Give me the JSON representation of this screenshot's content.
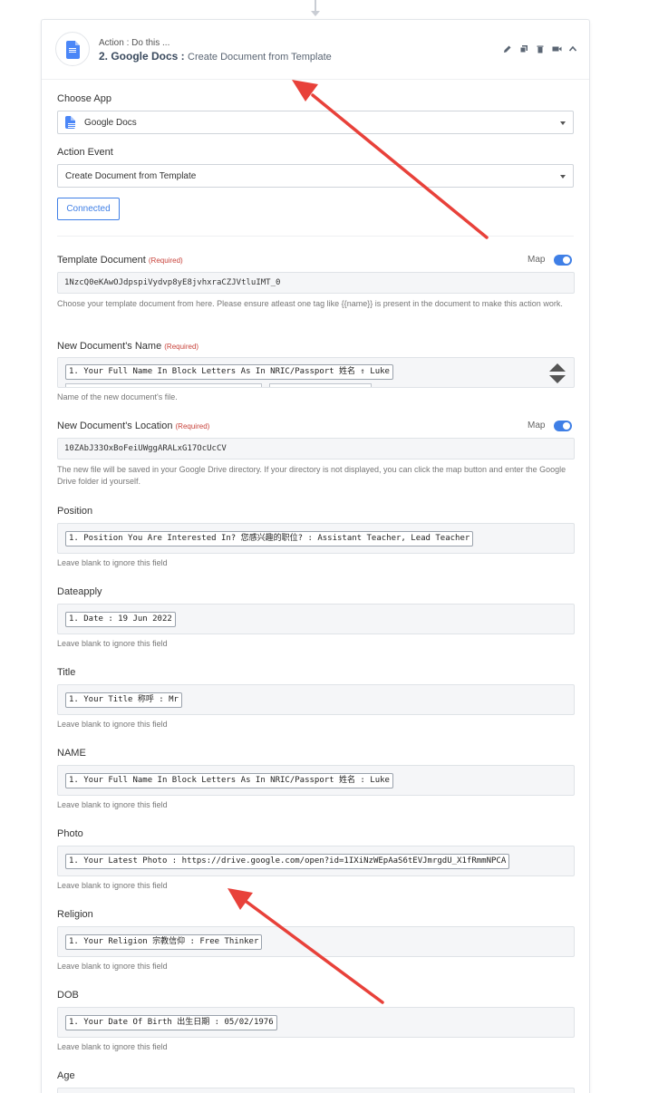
{
  "header": {
    "subtitle": "Action : Do this ...",
    "step": "2. Google Docs :",
    "action": "Create Document from Template",
    "tools": [
      "pencil-icon",
      "copy-icon",
      "trash-icon",
      "video-icon",
      "chevron-up-icon"
    ]
  },
  "choose_app": {
    "label": "Choose App",
    "value": "Google Docs"
  },
  "action_event": {
    "label": "Action Event",
    "value": "Create Document from Template"
  },
  "connected_label": "Connected",
  "required_tag": "(Required)",
  "map_label": "Map",
  "template_document": {
    "label": "Template Document",
    "value": "1NzcQ0eKAwOJdpspiVydvp8yE8jvhxraCZJVtluIMT_0",
    "help": "Choose your template document from here. Please ensure atleast one tag like {{name}} is present in the document to make this action work."
  },
  "new_doc_name": {
    "label": "New Document's Name",
    "chip": "1. Your Full Name In Block Letters As In NRIC/Passport 姓名 : Luke",
    "separator": "-",
    "help": "Name of the new document's file."
  },
  "new_doc_location": {
    "label": "New Document's Location",
    "value": "10ZAbJ33OxBoFeiUWggARALxG17OcUcCV",
    "help": "The new file will be saved in your Google Drive directory. If your directory is not displayed, you can click the map button and enter the Google Drive folder id yourself."
  },
  "blank_help": "Leave blank to ignore this field",
  "fields": [
    {
      "label": "Position",
      "chip": "1. Position You Are Interested In? 您感兴趣的职位? : Assistant Teacher, Lead Teacher"
    },
    {
      "label": "Dateapply",
      "chip": "1. Date : 19 Jun 2022"
    },
    {
      "label": "Title",
      "chip": "1. Your Title 称呼 : Mr"
    },
    {
      "label": "NAME",
      "chip": "1. Your Full Name In Block Letters As In NRIC/Passport 姓名 : Luke"
    },
    {
      "label": "Photo",
      "chip": "1. Your Latest Photo : https://drive.google.com/open?id=1IXiNzWEpAaS6tEVJmrgdU_X1fRmmNPCA"
    },
    {
      "label": "Religion",
      "chip": "1. Your Religion 宗教信仰 : Free Thinker"
    },
    {
      "label": "DOB",
      "chip": "1. Your Date Of Birth 出生日期 : 05/02/1976"
    },
    {
      "label": "Age"
    }
  ],
  "colors": {
    "accent": "#3f7fe6",
    "required": "#c8433b",
    "annotation_arrow": "#e8413a"
  }
}
